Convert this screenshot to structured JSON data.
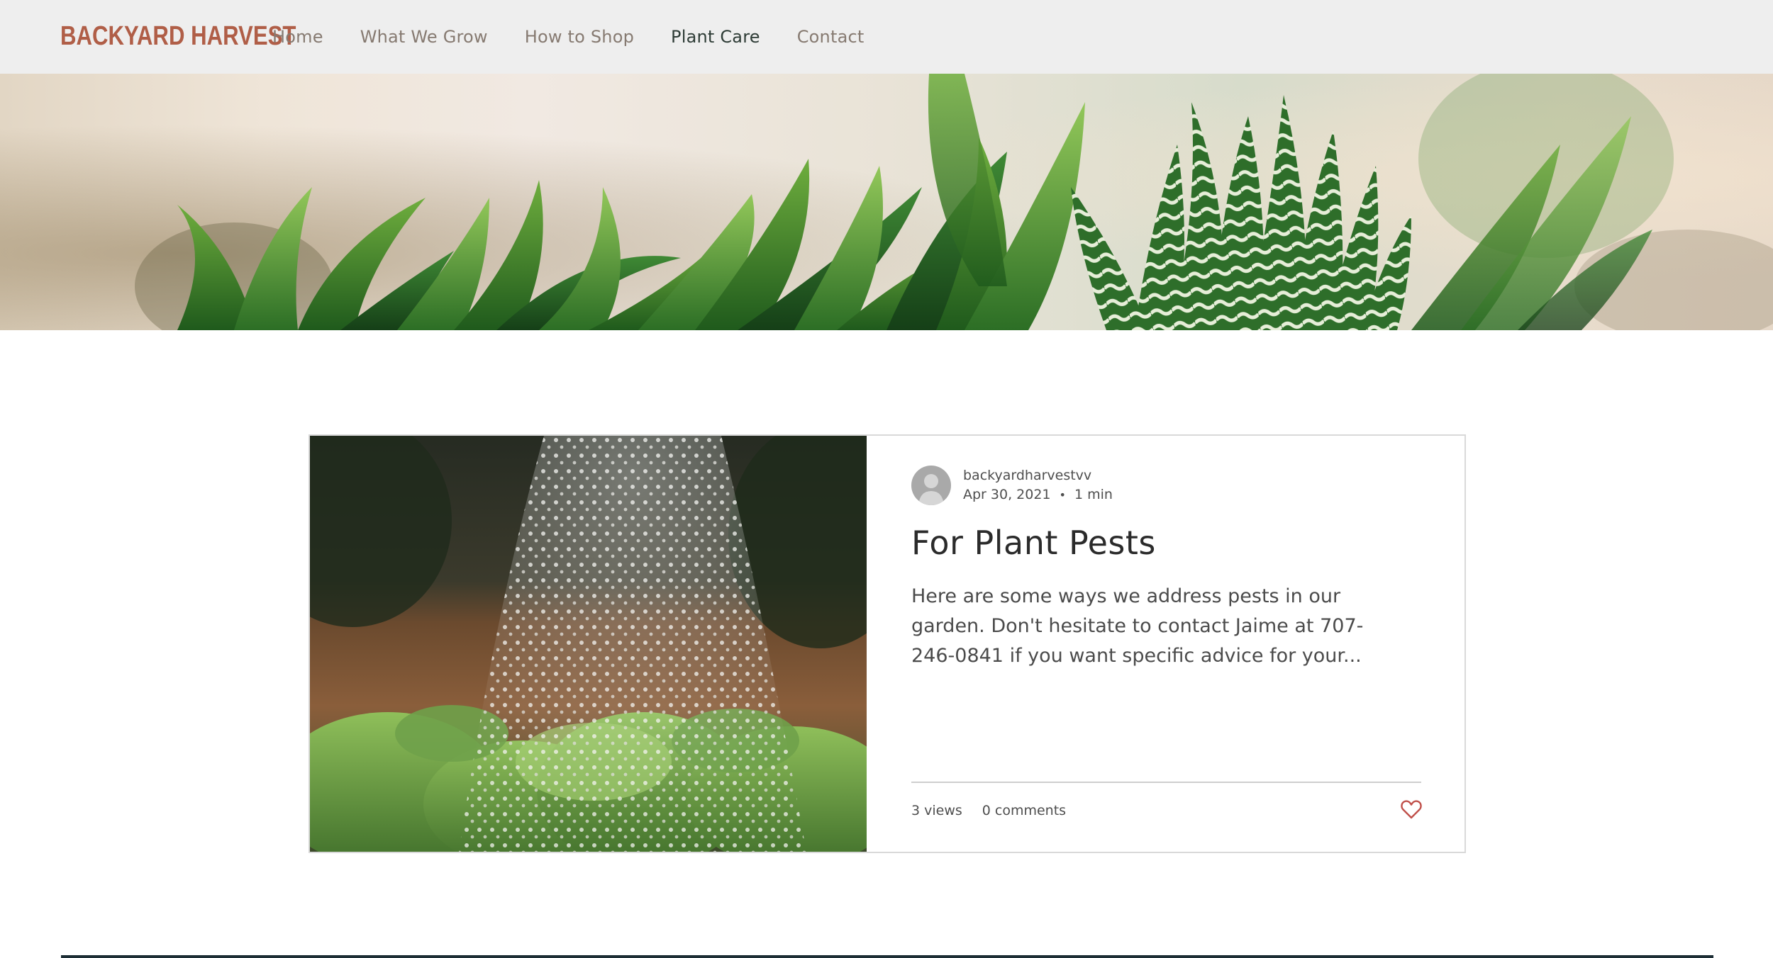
{
  "site": {
    "logo": "BACKYARD HARVEST"
  },
  "nav": {
    "items": [
      {
        "label": "Home",
        "active": false
      },
      {
        "label": "What We Grow",
        "active": false
      },
      {
        "label": "How to Shop",
        "active": false
      },
      {
        "label": "Plant Care",
        "active": true
      },
      {
        "label": "Contact",
        "active": false
      }
    ]
  },
  "post": {
    "author": "backyardharvestvv",
    "date": "Apr 30, 2021",
    "separator": "•",
    "read_time": "1 min",
    "title": "For Plant Pests",
    "excerpt": "Here are some ways we address pests in our garden. Don't hesitate to contact Jaime at 707-246-0841 if you want specific advice for your...",
    "views": "3 views",
    "comments": "0 comments",
    "like_icon": "heart-outline-icon"
  },
  "colors": {
    "logo": "#b05e47",
    "nav_text": "#867a71",
    "nav_active": "#2e3c36",
    "header_bg": "#eeeeee",
    "like": "#c0504a",
    "footer_rule": "#1d2e35"
  }
}
